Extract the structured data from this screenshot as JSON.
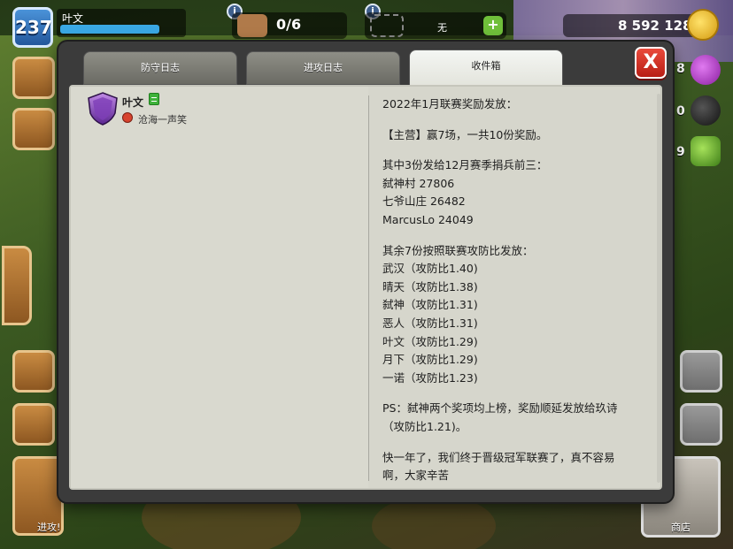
{
  "hud": {
    "level": "237",
    "player_name": "叶文",
    "builders": "0/6",
    "builders_info": "i",
    "shield_info": "i",
    "shield_status": "无",
    "gold": "8 592 128",
    "elixir_partial": "8",
    "dark_partial": "0",
    "gems_partial": "9",
    "attack_label": "进攻!",
    "shop_label": "商店"
  },
  "modal": {
    "tabs": [
      {
        "label": "防守日志",
        "active": false
      },
      {
        "label": "进攻日志",
        "active": false
      },
      {
        "label": "收件箱",
        "active": true
      }
    ],
    "close_label": "X",
    "mail": {
      "sender": "叶文",
      "clan": "沧海一声笑",
      "body": [
        [
          "2022年1月联赛奖励发放："
        ],
        [
          "【主营】赢7场，一共10份奖励。"
        ],
        [
          "其中3份发给12月赛季捐兵前三：",
          "弑神村 27806",
          "七爷山庄 26482",
          "MarcusLo 24049"
        ],
        [
          "其余7份按照联赛攻防比发放：",
          "武汉（攻防比1.40)",
          "晴天（攻防比1.38)",
          "弑神（攻防比1.31)",
          "恶人（攻防比1.31)",
          "叶文（攻防比1.29)",
          "月下（攻防比1.29)",
          "一诺（攻防比1.23)"
        ],
        [
          "PS：弑神两个奖项均上榜，奖励顺延发放给玖诗",
          "（攻防比1.21)。"
        ],
        [
          "快一年了，我们终于晋级冠军联赛了，真不容易",
          "啊，大家辛苦"
        ]
      ]
    }
  },
  "colors": {
    "close_button": "#d9352a",
    "active_tab": "#eef0ec",
    "inactive_tab": "#7e7e77",
    "content_bg": "#d6d6cc",
    "frame": "#3b3b3b"
  }
}
